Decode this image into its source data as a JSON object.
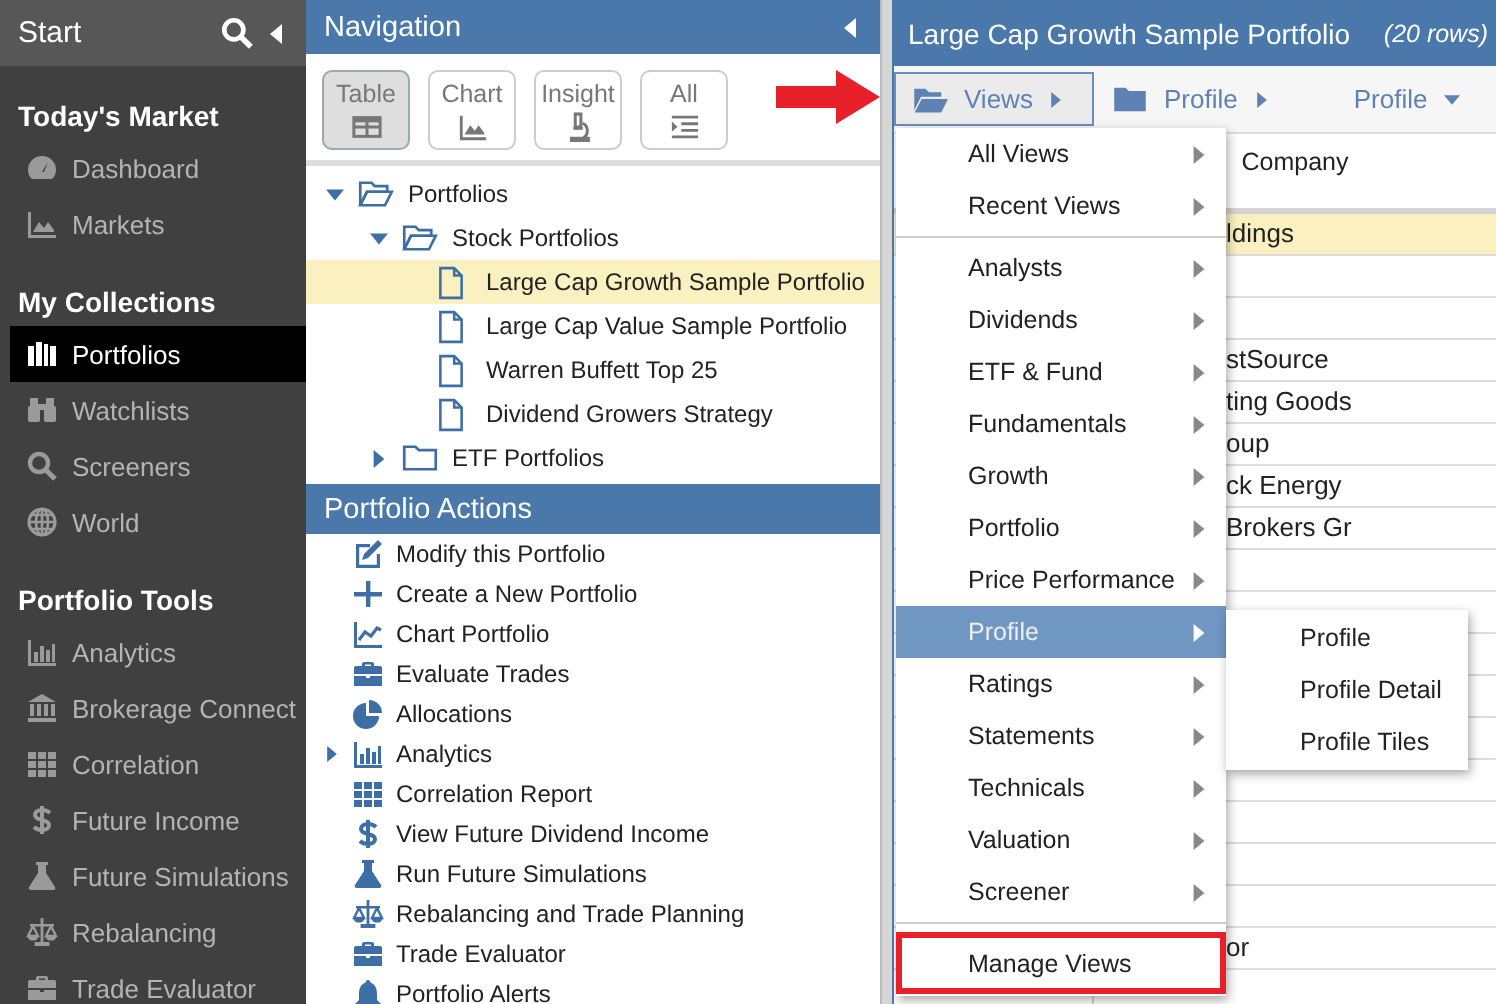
{
  "sidebar": {
    "title": "Start",
    "sections": [
      {
        "heading": "Today's Market",
        "items": [
          {
            "label": "Dashboard",
            "selected": false
          },
          {
            "label": "Markets",
            "selected": false
          }
        ]
      },
      {
        "heading": "My Collections",
        "items": [
          {
            "label": "Portfolios",
            "selected": true
          },
          {
            "label": "Watchlists",
            "selected": false
          },
          {
            "label": "Screeners",
            "selected": false
          },
          {
            "label": "World",
            "selected": false
          }
        ]
      },
      {
        "heading": "Portfolio Tools",
        "items": [
          {
            "label": "Analytics",
            "selected": false
          },
          {
            "label": "Brokerage Connect",
            "selected": false
          },
          {
            "label": "Correlation",
            "selected": false
          },
          {
            "label": "Future Income",
            "selected": false
          },
          {
            "label": "Future Simulations",
            "selected": false
          },
          {
            "label": "Rebalancing",
            "selected": false
          },
          {
            "label": "Trade Evaluator",
            "selected": false
          }
        ]
      }
    ]
  },
  "navigation": {
    "title": "Navigation",
    "view_buttons": [
      {
        "label": "Table",
        "selected": true
      },
      {
        "label": "Chart",
        "selected": false
      },
      {
        "label": "Insight",
        "selected": false
      },
      {
        "label": "All",
        "selected": false
      }
    ],
    "tree": [
      {
        "label": "Portfolios",
        "expanded": true,
        "children": [
          {
            "label": "Stock Portfolios",
            "expanded": true,
            "children": [
              {
                "label": "Large Cap Growth Sample Portfolio",
                "selected": true
              },
              {
                "label": "Large Cap Value Sample Portfolio",
                "selected": false
              },
              {
                "label": "Warren Buffett Top 25",
                "selected": false
              },
              {
                "label": "Dividend Growers Strategy",
                "selected": false
              }
            ]
          },
          {
            "label": "ETF Portfolios",
            "expanded": false
          }
        ]
      }
    ]
  },
  "portfolio_actions": {
    "title": "Portfolio Actions",
    "items": [
      {
        "label": "Modify this Portfolio",
        "kind": "action"
      },
      {
        "label": "Create a New Portfolio",
        "kind": "action"
      },
      {
        "label": "Chart Portfolio",
        "kind": "action"
      },
      {
        "label": "Evaluate Trades",
        "kind": "action"
      },
      {
        "label": "Allocations",
        "kind": "action"
      },
      {
        "label": "Analytics",
        "kind": "group"
      },
      {
        "label": "Correlation Report",
        "kind": "action"
      },
      {
        "label": "View Future Dividend Income",
        "kind": "action"
      },
      {
        "label": "Run Future Simulations",
        "kind": "action"
      },
      {
        "label": "Rebalancing and Trade Planning",
        "kind": "action"
      },
      {
        "label": "Trade Evaluator",
        "kind": "action"
      },
      {
        "label": "Portfolio Alerts",
        "kind": "action"
      }
    ]
  },
  "portfolio": {
    "title": "Large Cap Growth Sample Portfolio",
    "row_count": "(20 rows)",
    "toolbar": [
      {
        "label": "Views",
        "kind": "menu",
        "expanded": true
      },
      {
        "label": "Profile",
        "kind": "breadcrumb"
      },
      {
        "label": "Profile",
        "kind": "dropdown"
      }
    ],
    "table": {
      "columns": [
        "Company"
      ],
      "rows": [
        {
          "company": "ldings",
          "selected": true
        },
        {
          "selected": false
        },
        {
          "selected": false
        },
        {
          "company": "stSource",
          "selected": false
        },
        {
          "company": "ting Goods",
          "selected": false
        },
        {
          "company": "oup",
          "selected": false
        },
        {
          "company": "ck Energy",
          "selected": false
        },
        {
          "company": "Brokers Gr",
          "selected": false
        },
        {
          "selected": false
        },
        {
          "selected": false
        },
        {
          "selected": false
        },
        {
          "selected": false
        },
        {
          "selected": false
        },
        {
          "selected": false
        },
        {
          "selected": false
        },
        {
          "selected": false
        },
        {
          "selected": false
        },
        {
          "company": "or",
          "selected": false
        },
        {
          "selected": false
        }
      ]
    }
  },
  "views_menu": {
    "sections": [
      [
        {
          "label": "All Views",
          "kind": "submenu",
          "selected": false,
          "highlighted": false
        },
        {
          "label": "Recent Views",
          "kind": "submenu",
          "selected": false,
          "highlighted": false
        }
      ],
      [
        {
          "label": "Analysts",
          "kind": "submenu",
          "selected": false,
          "highlighted": false
        },
        {
          "label": "Dividends",
          "kind": "submenu",
          "selected": false,
          "highlighted": false
        },
        {
          "label": "ETF & Fund",
          "kind": "submenu",
          "selected": false,
          "highlighted": false
        },
        {
          "label": "Fundamentals",
          "kind": "submenu",
          "selected": false,
          "highlighted": false
        },
        {
          "label": "Growth",
          "kind": "submenu",
          "selected": false,
          "highlighted": false
        },
        {
          "label": "Portfolio",
          "kind": "submenu",
          "selected": false,
          "highlighted": false
        },
        {
          "label": "Price Performance",
          "kind": "submenu",
          "selected": false,
          "highlighted": false
        },
        {
          "label": "Profile",
          "kind": "submenu",
          "selected": true,
          "highlighted": false
        },
        {
          "label": "Ratings",
          "kind": "submenu",
          "selected": false,
          "highlighted": false
        },
        {
          "label": "Statements",
          "kind": "submenu",
          "selected": false,
          "highlighted": false
        },
        {
          "label": "Technicals",
          "kind": "submenu",
          "selected": false,
          "highlighted": false
        },
        {
          "label": "Valuation",
          "kind": "submenu",
          "selected": false,
          "highlighted": false
        },
        {
          "label": "Screener",
          "kind": "submenu",
          "selected": false,
          "highlighted": false
        }
      ],
      [
        {
          "label": "Manage Views",
          "kind": "action",
          "selected": false,
          "highlighted": true
        }
      ]
    ],
    "submenu": {
      "items": [
        "Profile",
        "Profile Detail",
        "Profile Tiles"
      ]
    }
  }
}
